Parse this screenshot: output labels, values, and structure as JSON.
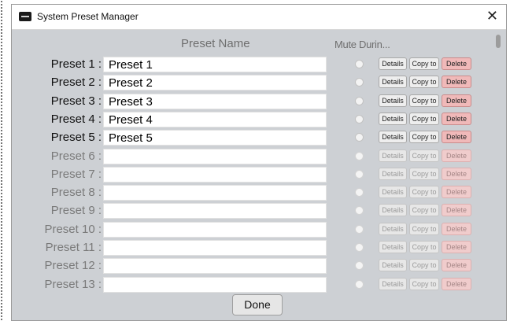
{
  "window": {
    "title": "System Preset Manager",
    "close_glyph": "✕"
  },
  "columns": {
    "preset_name": "Preset Name",
    "mute_during": "Mute Durin..."
  },
  "buttons": {
    "details": "Details",
    "copy_to": "Copy to",
    "delete": "Delete",
    "done": "Done"
  },
  "presets": [
    {
      "label": "Preset 1 :",
      "name": "Preset 1",
      "active": true
    },
    {
      "label": "Preset 2 :",
      "name": "Preset 2",
      "active": true
    },
    {
      "label": "Preset 3 :",
      "name": "Preset 3",
      "active": true
    },
    {
      "label": "Preset 4 :",
      "name": "Preset 4",
      "active": true
    },
    {
      "label": "Preset 5 :",
      "name": "Preset 5",
      "active": true
    },
    {
      "label": "Preset 6 :",
      "name": "",
      "active": false
    },
    {
      "label": "Preset 7 :",
      "name": "",
      "active": false
    },
    {
      "label": "Preset 8 :",
      "name": "",
      "active": false
    },
    {
      "label": "Preset 9 :",
      "name": "",
      "active": false
    },
    {
      "label": "Preset 10 :",
      "name": "",
      "active": false
    },
    {
      "label": "Preset 11 :",
      "name": "",
      "active": false
    },
    {
      "label": "Preset 12 :",
      "name": "",
      "active": false
    },
    {
      "label": "Preset 13 :",
      "name": "",
      "active": false
    }
  ],
  "colors": {
    "dialog_bg": "#cdd0d4",
    "delete_button": "#f0b9b9"
  }
}
